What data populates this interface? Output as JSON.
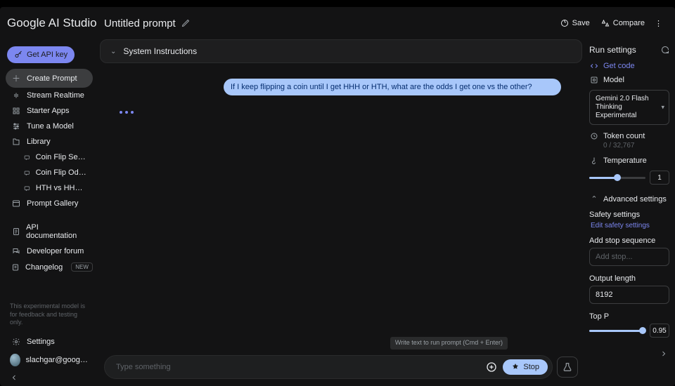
{
  "brand": "Google AI Studio",
  "prompt_title": "Untitled prompt",
  "top_actions": {
    "save": "Save",
    "compare": "Compare"
  },
  "sidebar": {
    "api_key": "Get API key",
    "items": [
      {
        "label": "Create Prompt"
      },
      {
        "label": "Stream Realtime"
      },
      {
        "label": "Starter Apps"
      },
      {
        "label": "Tune a Model"
      },
      {
        "label": "Library"
      }
    ],
    "library_children": [
      "Coin Flip Sequence Pr...",
      "Coin Flip Odds: HHH v...",
      "HTH vs HHH Coin Flips"
    ],
    "gallery": "Prompt Gallery",
    "secondary": [
      {
        "label": "API documentation"
      },
      {
        "label": "Developer forum"
      },
      {
        "label": "Changelog",
        "badge": "NEW"
      }
    ],
    "disclaimer": "This experimental model is for feedback and testing only.",
    "settings": "Settings",
    "user_email": "slachgar@google.com"
  },
  "system_header": "System Instructions",
  "conversation": {
    "user_message": "If I keep flipping a coin until I get HHH or HTH, what are the odds I get one vs the other?"
  },
  "input": {
    "placeholder": "Type something",
    "tooltip": "Write text to run prompt (Cmd + Enter)",
    "stop_label": "Stop"
  },
  "run_settings": {
    "title": "Run settings",
    "get_code": "Get code",
    "model_label": "Model",
    "model_value": "Gemini 2.0 Flash Thinking Experimental",
    "token_count_label": "Token count",
    "token_count_value": "0 / 32,767",
    "temperature_label": "Temperature",
    "temperature_value": "1",
    "advanced_label": "Advanced settings",
    "safety_label": "Safety settings",
    "edit_safety": "Edit safety settings",
    "stop_seq_label": "Add stop sequence",
    "stop_seq_placeholder": "Add stop...",
    "output_length_label": "Output length",
    "output_length_value": "8192",
    "top_p_label": "Top P",
    "top_p_value": "0.95"
  }
}
